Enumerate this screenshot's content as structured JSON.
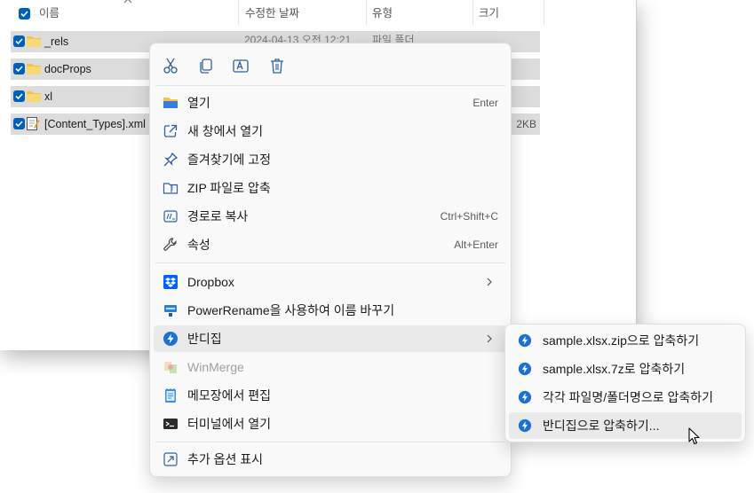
{
  "explorer": {
    "columns": {
      "name": "이름",
      "modified": "수정한 날짜",
      "type": "유형",
      "size": "크기"
    },
    "files": [
      {
        "name": "_rels",
        "icon": "folder-icon",
        "modified": "2024-04-13 오전 12:21",
        "type": "파일 폴더",
        "size": ""
      },
      {
        "name": "docProps",
        "icon": "folder-icon",
        "modified": "",
        "type": "",
        "size": ""
      },
      {
        "name": "xl",
        "icon": "folder-icon",
        "modified": "",
        "type": "",
        "size": ""
      },
      {
        "name": "[Content_Types].xml",
        "icon": "xml-file-icon",
        "modified": "",
        "type": "",
        "size": "2KB"
      }
    ]
  },
  "context_menu": {
    "icon_bar": [
      "cut-icon",
      "copy-icon",
      "rename-icon",
      "delete-icon"
    ],
    "items": [
      {
        "label": "열기",
        "shortcut": "Enter",
        "icon": "open-folder-icon"
      },
      {
        "label": "새 창에서 열기",
        "shortcut": "",
        "icon": "open-new-window-icon"
      },
      {
        "label": "즐겨찾기에 고정",
        "shortcut": "",
        "icon": "pin-icon"
      },
      {
        "label": "ZIP 파일로 압축",
        "shortcut": "",
        "icon": "zip-icon"
      },
      {
        "label": "경로로 복사",
        "shortcut": "Ctrl+Shift+C",
        "icon": "copy-path-icon"
      },
      {
        "label": "속성",
        "shortcut": "Alt+Enter",
        "icon": "wrench-icon"
      },
      {
        "label": "Dropbox",
        "shortcut": "",
        "icon": "dropbox-icon",
        "submenu": true
      },
      {
        "label": "PowerRename을 사용하여 이름 바꾸기",
        "shortcut": "",
        "icon": "powerrename-icon"
      },
      {
        "label": "반디집",
        "shortcut": "",
        "icon": "bandizip-icon",
        "submenu": true,
        "highlighted": true
      },
      {
        "label": "WinMerge",
        "shortcut": "",
        "icon": "winmerge-icon",
        "disabled": true
      },
      {
        "label": "메모장에서 편집",
        "shortcut": "",
        "icon": "notepad-icon"
      },
      {
        "label": "터미널에서 열기",
        "shortcut": "",
        "icon": "terminal-icon"
      },
      {
        "label": "추가 옵션 표시",
        "shortcut": "",
        "icon": "more-options-icon"
      }
    ]
  },
  "submenu": {
    "items": [
      {
        "label": "sample.xlsx.zip으로 압축하기",
        "icon": "bandizip-icon"
      },
      {
        "label": "sample.xlsx.7z로 압축하기",
        "icon": "bandizip-icon"
      },
      {
        "label": "각각 파일명/폴더명으로 압축하기",
        "icon": "bandizip-icon"
      },
      {
        "label": "반디집으로 압축하기...",
        "icon": "bandizip-icon",
        "highlighted": true
      }
    ]
  },
  "colors": {
    "accent": "#005fb8",
    "folder": "#f2c24b",
    "selection": "#dcdcdc",
    "menu_bg": "#f9f9f9",
    "bandizip": "#1b6fd6"
  }
}
